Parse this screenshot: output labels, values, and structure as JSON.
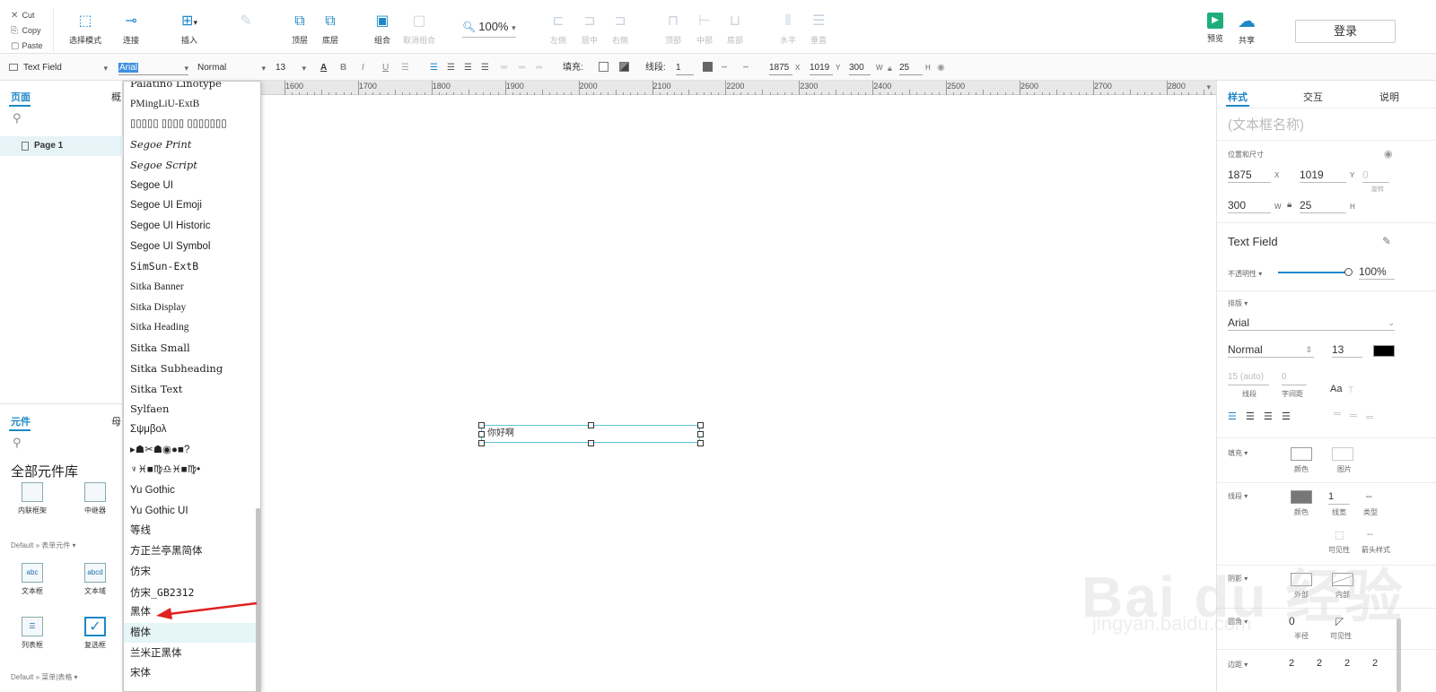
{
  "clipboard": {
    "cut": "Cut",
    "copy": "Copy",
    "paste": "Paste"
  },
  "toolbar": {
    "tools": [
      {
        "label": "选择模式",
        "icon": "select-mode-icon",
        "glyph": "⬚"
      },
      {
        "label": "连接",
        "icon": "connect-icon",
        "glyph": "⊸"
      },
      {
        "label": "插入",
        "icon": "insert-icon",
        "glyph": "⊞"
      },
      {
        "label": "",
        "icon": "pen-icon",
        "glyph": "✎"
      },
      {
        "label": "顶层",
        "icon": "bring-to-front-icon",
        "glyph": "⧉"
      },
      {
        "label": "底层",
        "icon": "send-to-back-icon",
        "glyph": "⧉"
      },
      {
        "label": "组合",
        "icon": "group-icon",
        "glyph": "▣"
      },
      {
        "label": "取消组合",
        "icon": "ungroup-icon",
        "glyph": "▢"
      },
      {
        "label": "左侧",
        "icon": "align-left-icon",
        "glyph": "⊏"
      },
      {
        "label": "居中",
        "icon": "align-center-icon",
        "glyph": "⊐"
      },
      {
        "label": "右侧",
        "icon": "align-right-icon",
        "glyph": "⊐"
      },
      {
        "label": "顶部",
        "icon": "align-top-icon",
        "glyph": "⊓"
      },
      {
        "label": "中部",
        "icon": "align-middle-icon",
        "glyph": "⊢"
      },
      {
        "label": "底部",
        "icon": "align-bottom-icon",
        "glyph": "⊔"
      },
      {
        "label": "水平",
        "icon": "distribute-horizontal-icon",
        "glyph": "⦀"
      },
      {
        "label": "垂直",
        "icon": "distribute-vertical-icon",
        "glyph": "☰"
      },
      {
        "label": "预览",
        "icon": "preview-icon",
        "glyph": "▶"
      },
      {
        "label": "共享",
        "icon": "share-cloud-icon",
        "glyph": "☁"
      }
    ],
    "zoom": "100%",
    "login": "登录"
  },
  "format": {
    "widget_type": "Text Field",
    "font": "Arial",
    "weight": "Normal",
    "size": "13",
    "fill_label": "填充:",
    "stroke_label": "线段:",
    "stroke_width": "1",
    "x": "1875",
    "x_label": "X",
    "y": "1019",
    "y_label": "Y",
    "w": "300",
    "w_label": "W",
    "h": "25",
    "h_label": "H"
  },
  "left": {
    "tab_pages": "页面",
    "tab_outline": "概",
    "page1": "Page 1",
    "tab_widgets": "元件",
    "tab_masters": "母",
    "library_title": "全部元件库",
    "lib_items": [
      "内联框架",
      "中继器"
    ],
    "form_section": "Default » 表单元件 ▾",
    "form_items": [
      "文本框",
      "文本域",
      "列表框",
      "复选框"
    ],
    "menu_section": "Default » 菜单|表格 ▾"
  },
  "dropdown": {
    "options": [
      "Palatino Linotype",
      "PMingLiU-ExtB",
      "▯▯▯▯▯ ▯▯▯▯ ▯▯▯▯▯▯▯",
      "Segoe Print",
      "Segoe Script",
      "Segoe UI",
      "Segoe UI Emoji",
      "Segoe UI Historic",
      "Segoe UI Symbol",
      "SimSun-ExtB",
      "Sitka Banner",
      "Sitka Display",
      "Sitka Heading",
      "Sitka Small",
      "Sitka Subheading",
      "Sitka Text",
      "Sylfaen",
      "Σψμβολ",
      "▸☗✂☗◉●■?",
      "♆♓■♍♎♓■♍•",
      "Yu Gothic",
      "Yu Gothic UI",
      "等线",
      "方正兰亭黑简体",
      "仿宋",
      "仿宋_GB2312",
      "黑体",
      "楷体",
      "兰米正黑体",
      "宋体"
    ],
    "highlighted_index": 27
  },
  "canvas": {
    "ruler": [
      "1600",
      "1700",
      "1800",
      "1900",
      "2000",
      "2100",
      "2200",
      "2300",
      "2400",
      "2500",
      "2600",
      "2700",
      "2800"
    ],
    "widget_text": "你好啊"
  },
  "right": {
    "tab_style": "样式",
    "tab_interact": "交互",
    "tab_notes": "说明",
    "name_placeholder": "(文本框名称)",
    "pos_size": "位置和尺寸",
    "x": "1875",
    "x_label": "X",
    "y": "1019",
    "y_label": "Y",
    "rotate": "0",
    "rotate_label": "旋转",
    "w": "300",
    "w_label": "W",
    "h": "25",
    "h_label": "H",
    "widget_name": "Text Field",
    "opacity_label": "不透明性 ▾",
    "opacity": "100%",
    "typography": "排版 ▾",
    "font": "Arial",
    "weight": "Normal",
    "size": "13",
    "line_height": "15 (auto)",
    "line_height_label": "线段",
    "char_spacing": "0",
    "char_spacing_label": "字间距",
    "fill_section": "填充 ▾",
    "fill_color_label": "颜色",
    "fill_image_label": "图片",
    "stroke_section": "线段 ▾",
    "stroke_color_label": "颜色",
    "stroke_width": "1",
    "stroke_width_label": "线宽",
    "stroke_type_label": "类型",
    "visibility_label": "可见性",
    "arrow_label": "箭头样式",
    "shadow_section": "阴影 ▾",
    "shadow_outer": "外部",
    "shadow_inner": "内部",
    "corner_section": "圆角 ▾",
    "corner_radius": "0",
    "corner_radius_label": "半径",
    "corner_visibility_label": "可见性",
    "padding_section": "边距 ▾",
    "padding": [
      "2",
      "2",
      "2",
      "2"
    ]
  },
  "watermark": {
    "text": "Bai du 经验",
    "url": "jingyan.baidu.com"
  },
  "colors": {
    "accent": "#1e88c7",
    "selection": "#5cc2d8",
    "highlight": "#e5f5f8",
    "arrow": "#e02020"
  }
}
